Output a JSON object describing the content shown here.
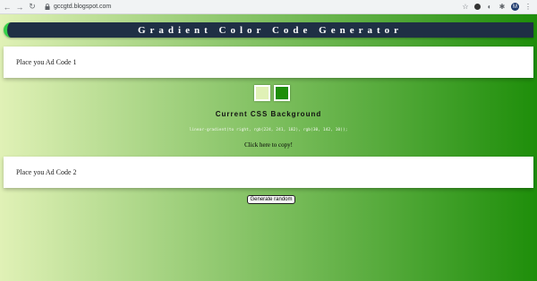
{
  "browser": {
    "url": "gccgtd.blogspot.com",
    "avatar_letter": "M"
  },
  "header": {
    "title": "Gradient Color Code Generator"
  },
  "ads": {
    "ad1": "Place you Ad Code 1",
    "ad2": "Place you Ad Code 2"
  },
  "colors": {
    "color1": "rgb(224, 241, 182)",
    "color2": "rgb(30, 142, 10)"
  },
  "main": {
    "heading": "Current CSS Background",
    "css_code": "linear-gradient(to right, rgb(224, 241, 182), rgb(30, 142, 10));",
    "copy_text": "Click here to copy!",
    "button_label": "Generate random"
  }
}
